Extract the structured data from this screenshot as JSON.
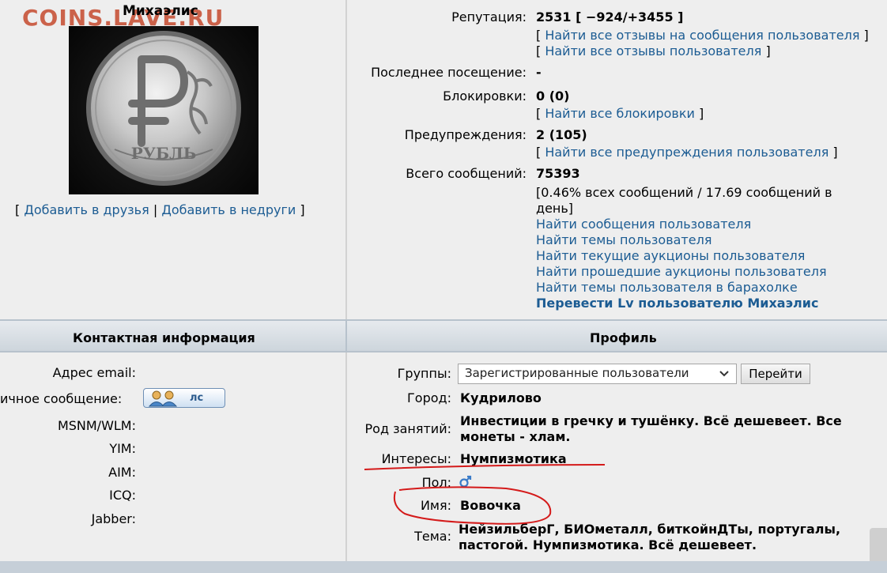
{
  "site": {
    "watermark": "COINS.LAVE.RU"
  },
  "user": {
    "name": "Михаэлис"
  },
  "friends": {
    "open": "[",
    "add_friend": "Добавить в друзья",
    "sep": "|",
    "add_foe": "Добавить в недруги",
    "close": "]"
  },
  "stats": {
    "reputation": {
      "label": "Репутация:",
      "value": "2531 [ −924/+3455 ]",
      "link1": "Найти все отзывы на сообщения пользователя",
      "link2": "Найти все отзывы пользователя"
    },
    "last_visit": {
      "label": "Последнее посещение:",
      "value": "-"
    },
    "blocks": {
      "label": "Блокировки:",
      "value": "0 (0)",
      "link": "Найти все блокировки"
    },
    "warnings": {
      "label": "Предупреждения:",
      "value": "2 (105)",
      "link": "Найти все предупреждения пользователя"
    },
    "posts": {
      "label": "Всего сообщений:",
      "value": "75393",
      "detail_line1": "[0.46% всех сообщений / 17.69 сообщений в",
      "detail_line2": "день]",
      "links": [
        "Найти сообщения пользователя",
        "Найти темы пользователя",
        "Найти текущие аукционы пользователя",
        "Найти прошедшие аукционы пользователя",
        "Найти темы пользователя в барахолке"
      ],
      "transfer": "Перевести Lv пользователю Михаэлис"
    }
  },
  "headers": {
    "contact": "Контактная информация",
    "profile": "Профиль"
  },
  "contact": {
    "email": "Адрес email:",
    "pm": "ичное сообщение:",
    "pm_button": "лс",
    "msn": "MSNM/WLM:",
    "yim": "YIM:",
    "aim": "AIM:",
    "icq": "ICQ:",
    "jabber": "Jabber:"
  },
  "profile": {
    "groups_label": "Группы:",
    "groups_value": "Зарегистрированные пользователи",
    "go_button": "Перейти",
    "city_label": "Город:",
    "city_value": "Кудрилово",
    "occupation_label": "Род занятий:",
    "occupation_line1": "Инвестиции в гречку и тушёнку. Всё дешевеет. Все",
    "occupation_line2": "монеты - хлам.",
    "interests_label": "Интересы:",
    "interests_value": "Нумпизмотика",
    "gender_label": "Пол:",
    "name_label": "Имя:",
    "name_value": "Вовочка",
    "theme_label": "Тема:",
    "theme_line1": "НейзильберГ, БИОметалл, биткойнДТы, португалы,",
    "theme_line2": "пастогой. Нумпизмотика. Всё дешевеет."
  },
  "colors": {
    "link": "#1c5c93",
    "annotation": "#d41a1a",
    "watermark": "#c9573d"
  }
}
